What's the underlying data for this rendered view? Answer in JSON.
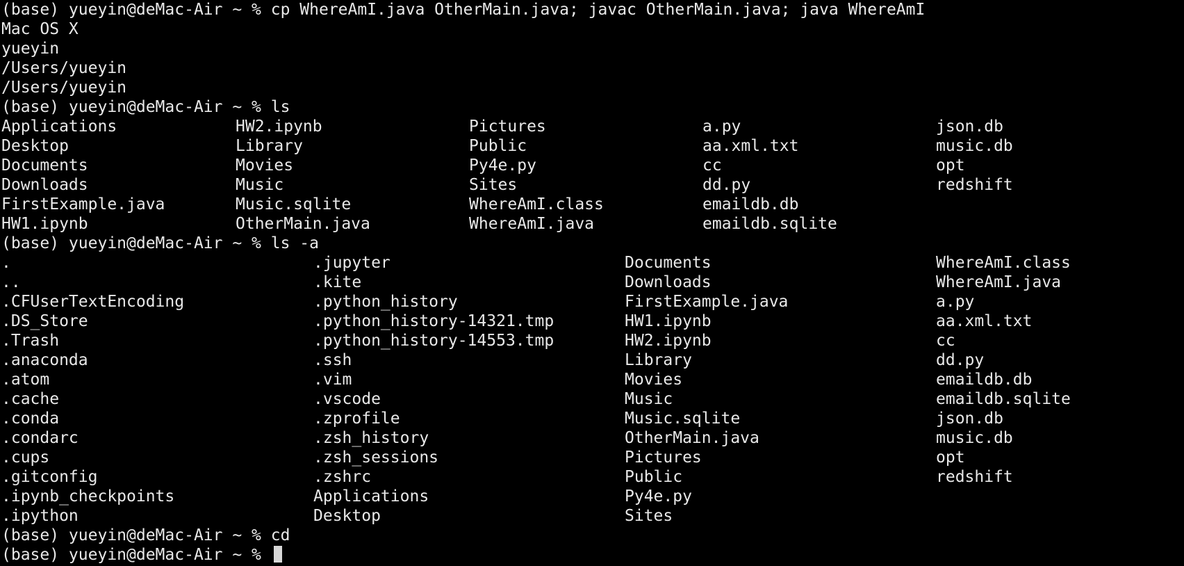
{
  "prompt": "(base) yueyin@deMac-Air ~ % ",
  "commands": {
    "cmd1": "cp WhereAmI.java OtherMain.java; javac OtherMain.java; java WhereAmI",
    "cmd2": "ls",
    "cmd3": "ls -a",
    "cmd4": "cd"
  },
  "output1": [
    "Mac OS X",
    "yueyin",
    "/Users/yueyin",
    "/Users/yueyin"
  ],
  "ls_rows": [
    [
      "Applications",
      "HW2.ipynb",
      "Pictures",
      "a.py",
      "json.db"
    ],
    [
      "Desktop",
      "Library",
      "Public",
      "aa.xml.txt",
      "music.db"
    ],
    [
      "Documents",
      "Movies",
      "Py4e.py",
      "cc",
      "opt"
    ],
    [
      "Downloads",
      "Music",
      "Sites",
      "dd.py",
      "redshift"
    ],
    [
      "FirstExample.java",
      "Music.sqlite",
      "WhereAmI.class",
      "emaildb.db",
      ""
    ],
    [
      "HW1.ipynb",
      "OtherMain.java",
      "WhereAmI.java",
      "emaildb.sqlite",
      ""
    ]
  ],
  "ls_a_rows": [
    [
      ".",
      ".jupyter",
      "Documents",
      "WhereAmI.class"
    ],
    [
      "..",
      ".kite",
      "Downloads",
      "WhereAmI.java"
    ],
    [
      ".CFUserTextEncoding",
      ".python_history",
      "FirstExample.java",
      "a.py"
    ],
    [
      ".DS_Store",
      ".python_history-14321.tmp",
      "HW1.ipynb",
      "aa.xml.txt"
    ],
    [
      ".Trash",
      ".python_history-14553.tmp",
      "HW2.ipynb",
      "cc"
    ],
    [
      ".anaconda",
      ".ssh",
      "Library",
      "dd.py"
    ],
    [
      ".atom",
      ".vim",
      "Movies",
      "emaildb.db"
    ],
    [
      ".cache",
      ".vscode",
      "Music",
      "emaildb.sqlite"
    ],
    [
      ".conda",
      ".zprofile",
      "Music.sqlite",
      "json.db"
    ],
    [
      ".condarc",
      ".zsh_history",
      "OtherMain.java",
      "music.db"
    ],
    [
      ".cups",
      ".zsh_sessions",
      "Pictures",
      "opt"
    ],
    [
      ".gitconfig",
      ".zshrc",
      "Public",
      "redshift"
    ],
    [
      ".ipynb_checkpoints",
      "Applications",
      "Py4e.py",
      ""
    ],
    [
      ".ipython",
      "Desktop",
      "Sites",
      ""
    ]
  ],
  "colors": {
    "background": "#000000",
    "text": "#e8e8e8",
    "cursor": "#d8d8d8"
  }
}
